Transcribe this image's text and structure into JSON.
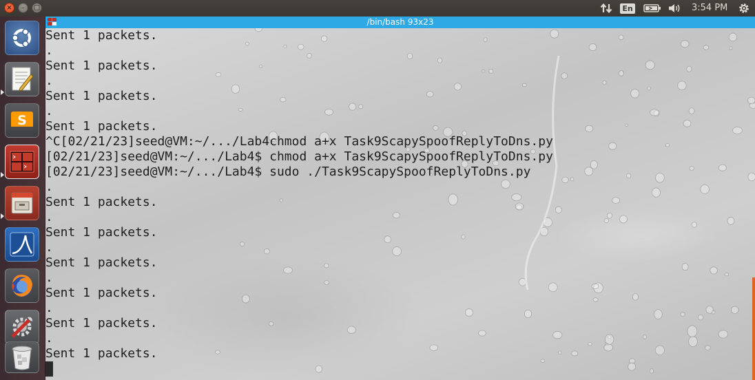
{
  "top_panel": {
    "language": "En",
    "clock": "3:54 PM",
    "icons": [
      "network-updown-icon",
      "keyboard-language-icon",
      "battery-icon",
      "volume-icon",
      "settings-gear-icon"
    ]
  },
  "window_controls": {
    "close_glyph": "×",
    "minimize_glyph": "–",
    "maximize_glyph": "□"
  },
  "launcher": {
    "items": [
      {
        "name": "ubuntu-dash",
        "icon": "ubuntu-logo-icon"
      },
      {
        "name": "text-editor",
        "icon": "text-editor-icon"
      },
      {
        "name": "sublime-text",
        "icon": "sublime-text-icon"
      },
      {
        "name": "terminal",
        "icon": "terminal-icon"
      },
      {
        "name": "file-manager",
        "icon": "file-cabinet-icon"
      },
      {
        "name": "wireshark",
        "icon": "wireshark-fin-icon"
      },
      {
        "name": "firefox",
        "icon": "firefox-icon"
      },
      {
        "name": "system-settings",
        "icon": "settings-tools-icon"
      },
      {
        "name": "trash",
        "icon": "trash-icon"
      }
    ]
  },
  "terminal": {
    "title": "/bin/bash 93x23",
    "lines": [
      "Sent 1 packets.",
      ".",
      "Sent 1 packets.",
      ".",
      "Sent 1 packets.",
      ".",
      "Sent 1 packets.",
      "^C[02/21/23]seed@VM:~/.../Lab4chmod a+x Task9ScapySpoofReplyToDns.py",
      "[02/21/23]seed@VM:~/.../Lab4$ chmod a+x Task9ScapySpoofReplyToDns.py",
      "[02/21/23]seed@VM:~/.../Lab4$ sudo ./Task9ScapySpoofReplyToDns.py",
      ".",
      "Sent 1 packets.",
      ".",
      "Sent 1 packets.",
      ".",
      "Sent 1 packets.",
      ".",
      "Sent 1 packets.",
      ".",
      "Sent 1 packets.",
      ".",
      "Sent 1 packets."
    ]
  },
  "colors": {
    "panel": "#3c3b37",
    "titlebar": "#2ea9e5",
    "accent": "#dd4814",
    "terminal_text": "#1e1e1e"
  }
}
